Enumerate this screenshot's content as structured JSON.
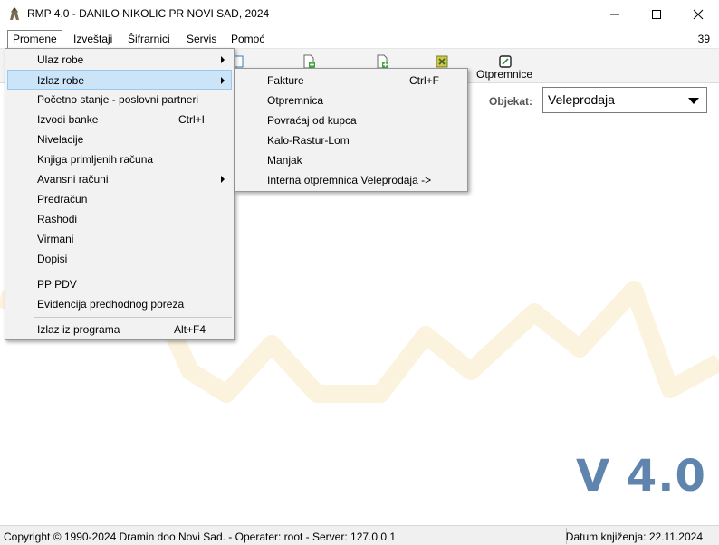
{
  "window": {
    "title": "RMP 4.0 - DANILO NIKOLIC PR NOVI SAD, 2024",
    "icon": "app-logo-icon"
  },
  "menubar": {
    "items": [
      "Promene",
      "Izveštaji",
      "Šifrarnici",
      "Servis",
      "Pomoć"
    ],
    "active": "Promene",
    "count": "39"
  },
  "toolbar": {
    "label": "Otpremnice"
  },
  "objekat": {
    "label": "Objekat:",
    "value": "Veleprodaja"
  },
  "main_menu": {
    "items": [
      {
        "label": "Ulaz robe",
        "submenu": true
      },
      {
        "label": "Izlaz robe",
        "submenu": true,
        "highlighted": true
      },
      {
        "label": "Početno stanje - poslovni partneri"
      },
      {
        "label": "Izvodi banke",
        "shortcut": "Ctrl+I"
      },
      {
        "label": "Nivelacije"
      },
      {
        "label": "Knjiga primljenih računa"
      },
      {
        "label": "Avansni računi",
        "submenu": true
      },
      {
        "label": "Predračun"
      },
      {
        "label": "Rashodi"
      },
      {
        "label": "Virmani"
      },
      {
        "label": "Dopisi"
      },
      {
        "label": "PP PDV"
      },
      {
        "label": "Evidencija predhodnog poreza"
      },
      {
        "label": "Izlaz iz programa",
        "shortcut": "Alt+F4"
      }
    ]
  },
  "sub_menu": {
    "items": [
      {
        "label": "Fakture",
        "shortcut": "Ctrl+F"
      },
      {
        "label": "Otpremnica"
      },
      {
        "label": "Povraćaj od kupca"
      },
      {
        "label": "Kalo-Rastur-Lom"
      },
      {
        "label": "Manjak"
      },
      {
        "label": "Interna otpremnica Veleprodaja ->"
      }
    ]
  },
  "version": "V 4.0",
  "statusbar": {
    "left": "Copyright © 1990-2024 Dramin doo Novi Sad. - Operater: root - Server: 127.0.0.1",
    "right": "Datum knjiženja: 22.11.2024"
  },
  "colors": {
    "menu_highlight": "#cce4f7",
    "version_text": "#5f84ae",
    "watermark": "#fbf3de"
  }
}
